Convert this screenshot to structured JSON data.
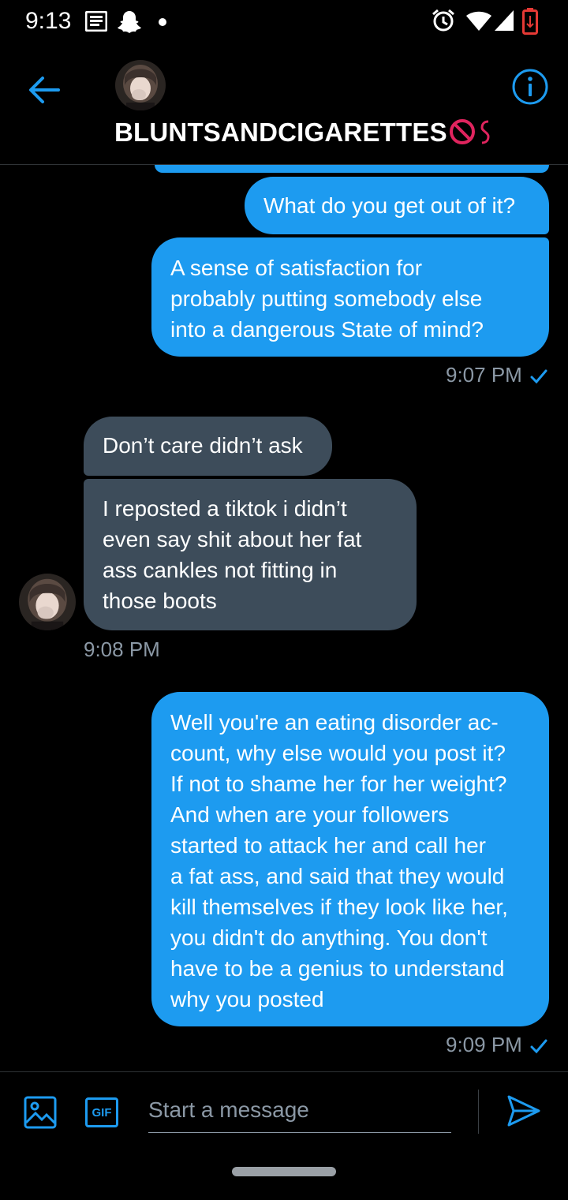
{
  "status_bar": {
    "time": "9:13",
    "icons": [
      "news-icon",
      "snapchat-icon",
      "notification-dot-icon",
      "alarm-icon",
      "wifi-icon",
      "signal-icon",
      "battery-low-icon"
    ]
  },
  "header": {
    "title": "BLUNTSANDCIGARETTES",
    "icons": [
      "back-arrow-icon",
      "info-icon",
      "prohibited-emoji-icon"
    ]
  },
  "messages": [
    {
      "direction": "out",
      "text": "What do you get out of it?"
    },
    {
      "direction": "out",
      "text": "A sense of satisfaction for\nprobably putting somebody else\ninto a dangerous State of mind?"
    },
    {
      "direction": "in",
      "text": "Don’t care didn’t ask"
    },
    {
      "direction": "in",
      "text": "I reposted a tiktok i didn’t\neven say shit about her fat\nass cankles not fitting in\nthose boots"
    },
    {
      "direction": "out",
      "text": "Well you're an eating disorder ac-\ncount, why else would you post it?\nIf not to shame her for her weight?\nAnd when are your followers\nstarted to attack her and call her\na fat ass, and said that they would\nkill themselves if they look like her,\nyou didn't do anything. You don't\nhave to be a genius to understand\nwhy you posted"
    }
  ],
  "timestamps": {
    "t1": "9:07 PM",
    "t2": "9:08 PM",
    "t3": "9:09 PM"
  },
  "composer": {
    "placeholder": "Start a message",
    "gif_label": "GIF"
  },
  "colors": {
    "background": "#000000",
    "outgoing_bubble": "#1d9bf0",
    "incoming_bubble": "#3d4c5a",
    "accent": "#1d9bf0",
    "muted_text": "#8b98a5"
  }
}
